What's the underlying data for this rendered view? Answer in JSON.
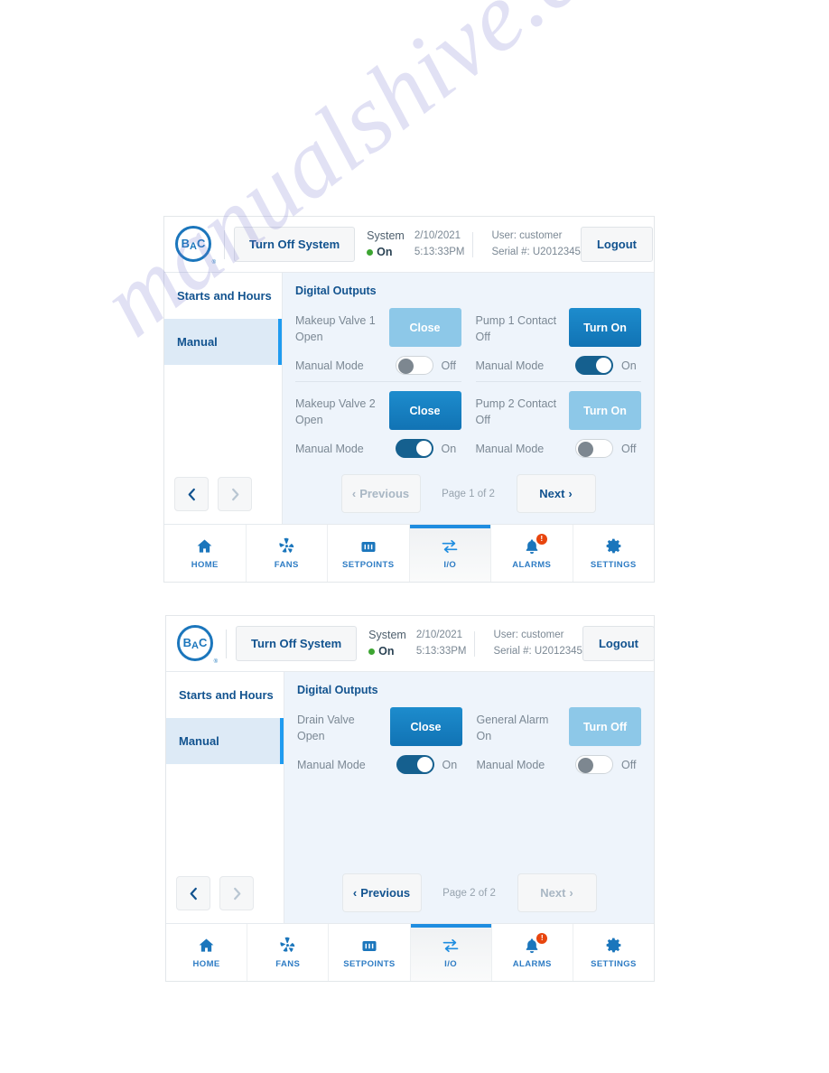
{
  "watermark": {
    "text": "manualshive.com"
  },
  "panels": [
    {
      "id": "panel-1",
      "header": {
        "logo_text": "BAC",
        "logo_registered": "®",
        "system_button": "Turn Off System",
        "system_label": "System",
        "system_state": "On",
        "date": "2/10/2021",
        "time": "5:13:33PM",
        "user": "User: customer",
        "serial": "Serial #: U2012345",
        "logout_button": "Logout"
      },
      "sidebar": {
        "items": [
          {
            "label": "Starts and Hours",
            "active": false
          },
          {
            "label": "Manual",
            "active": true
          }
        ],
        "prev_icon": "chevron-left-icon",
        "next_icon": "chevron-right-icon",
        "prev_enabled": true,
        "next_enabled": false
      },
      "section_title": "Digital Outputs",
      "outputs": [
        {
          "name": "Makeup Valve 1",
          "status": "Open",
          "action_label": "Close",
          "action_enabled": false,
          "manual_label": "Manual Mode",
          "manual_state": "Off",
          "manual_on": false
        },
        {
          "name": "Pump 1 Contact",
          "status": "Off",
          "action_label": "Turn On",
          "action_enabled": true,
          "manual_label": "Manual Mode",
          "manual_state": "On",
          "manual_on": true
        },
        {
          "name": "Makeup Valve 2",
          "status": "Open",
          "action_label": "Close",
          "action_enabled": true,
          "manual_label": "Manual Mode",
          "manual_state": "On",
          "manual_on": true
        },
        {
          "name": "Pump 2 Contact",
          "status": "Off",
          "action_label": "Turn On",
          "action_enabled": false,
          "manual_label": "Manual Mode",
          "manual_state": "Off",
          "manual_on": false
        }
      ],
      "pager": {
        "previous_label": "Previous",
        "previous_enabled": false,
        "page_info": "Page 1 of 2",
        "next_label": "Next",
        "next_enabled": true
      },
      "nav": [
        {
          "label": "HOME",
          "icon": "home-icon",
          "active": false,
          "badge": ""
        },
        {
          "label": "FANS",
          "icon": "fan-icon",
          "active": false,
          "badge": ""
        },
        {
          "label": "SETPOINTS",
          "icon": "setpoints-icon",
          "active": false,
          "badge": ""
        },
        {
          "label": "I/O",
          "icon": "io-arrows-icon",
          "active": true,
          "badge": ""
        },
        {
          "label": "ALARMS",
          "icon": "bell-icon",
          "active": false,
          "badge": "!"
        },
        {
          "label": "SETTINGS",
          "icon": "gear-icon",
          "active": false,
          "badge": ""
        }
      ]
    },
    {
      "id": "panel-2",
      "header": {
        "logo_text": "BAC",
        "logo_registered": "®",
        "system_button": "Turn Off System",
        "system_label": "System",
        "system_state": "On",
        "date": "2/10/2021",
        "time": "5:13:33PM",
        "user": "User: customer",
        "serial": "Serial #: U2012345",
        "logout_button": "Logout"
      },
      "sidebar": {
        "items": [
          {
            "label": "Starts and Hours",
            "active": false
          },
          {
            "label": "Manual",
            "active": true
          }
        ],
        "prev_icon": "chevron-left-icon",
        "next_icon": "chevron-right-icon",
        "prev_enabled": true,
        "next_enabled": false
      },
      "section_title": "Digital Outputs",
      "outputs": [
        {
          "name": "Drain Valve",
          "status": "Open",
          "action_label": "Close",
          "action_enabled": true,
          "manual_label": "Manual Mode",
          "manual_state": "On",
          "manual_on": true
        },
        {
          "name": "General Alarm",
          "status": "On",
          "action_label": "Turn Off",
          "action_enabled": false,
          "manual_label": "Manual Mode",
          "manual_state": "Off",
          "manual_on": false
        }
      ],
      "pager": {
        "previous_label": "Previous",
        "previous_enabled": true,
        "page_info": "Page 2 of 2",
        "next_label": "Next",
        "next_enabled": false
      },
      "nav": [
        {
          "label": "HOME",
          "icon": "home-icon",
          "active": false,
          "badge": ""
        },
        {
          "label": "FANS",
          "icon": "fan-icon",
          "active": false,
          "badge": ""
        },
        {
          "label": "SETPOINTS",
          "icon": "setpoints-icon",
          "active": false,
          "badge": ""
        },
        {
          "label": "I/O",
          "icon": "io-arrows-icon",
          "active": true,
          "badge": ""
        },
        {
          "label": "ALARMS",
          "icon": "bell-icon",
          "active": false,
          "badge": "!"
        },
        {
          "label": "SETTINGS",
          "icon": "gear-icon",
          "active": false,
          "badge": ""
        }
      ]
    }
  ],
  "colors": {
    "brand_blue": "#1b76bc",
    "deep_blue": "#12538f",
    "accent_blue": "#1f8de0",
    "light_blue": "#8dc8e8",
    "toggle_on": "#15608f",
    "alarm_red": "#e8450e",
    "status_green": "#3da532",
    "content_bg": "#eef4fb",
    "sidebar_active_bg": "#ddeaf6"
  }
}
